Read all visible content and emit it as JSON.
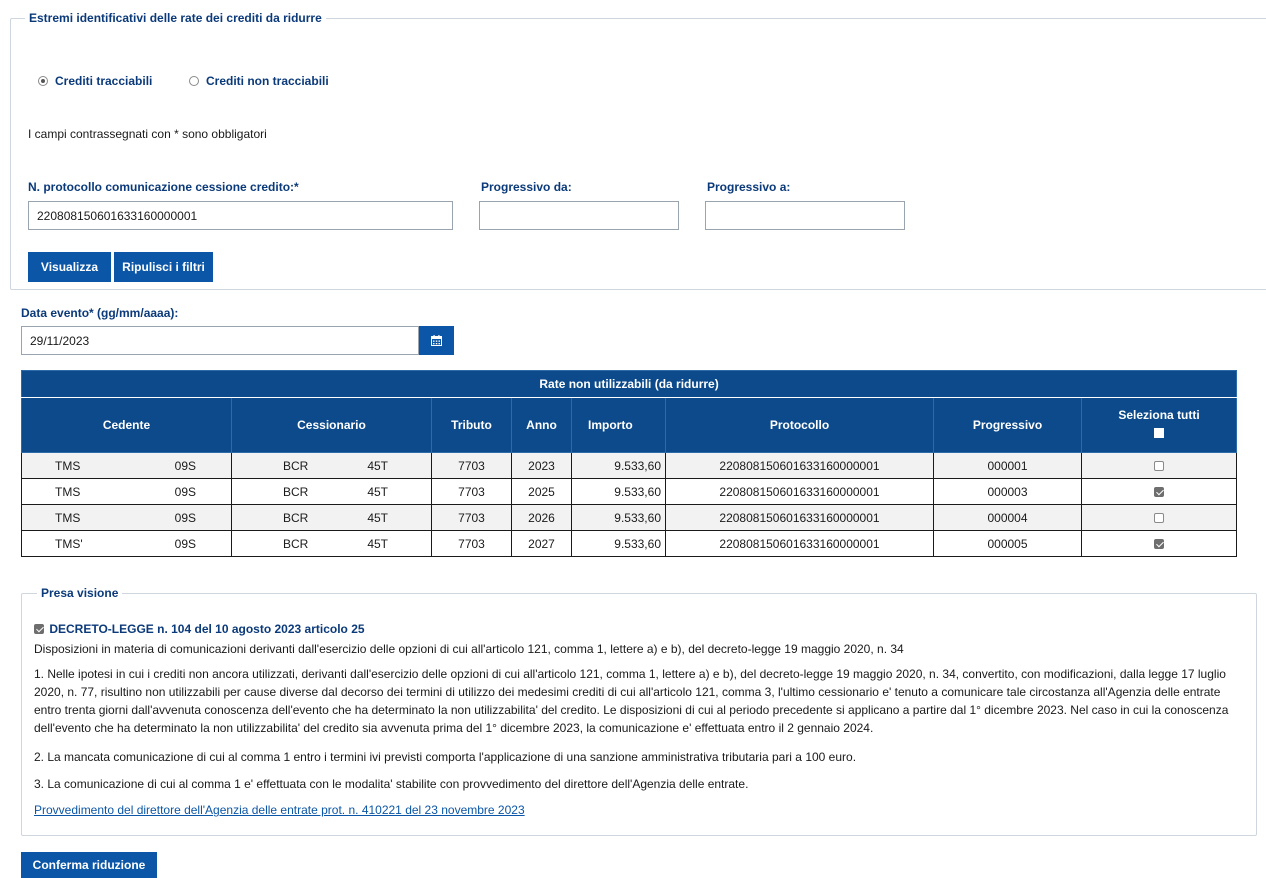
{
  "filters_section": {
    "legend": "Estremi identificativi delle rate dei crediti da ridurre",
    "radio_tracciabili": "Crediti tracciabili",
    "radio_non_tracciabili": "Crediti non tracciabili",
    "required_note": "I campi contrassegnati con * sono obbligatori",
    "protocollo_label": "N. protocollo comunicazione cessione credito:*",
    "protocollo_value": "220808150601633160000001",
    "progressivo_da_label": "Progressivo da:",
    "progressivo_da_value": "",
    "progressivo_a_label": "Progressivo a:",
    "progressivo_a_value": "",
    "btn_visualizza": "Visualizza",
    "btn_ripulisci": "Ripulisci i filtri"
  },
  "data_evento": {
    "label": "Data evento* (gg/mm/aaaa):",
    "value": "29/11/2023",
    "calendar_icon": "calendar-icon"
  },
  "table": {
    "title": "Rate non utilizzabili (da ridurre)",
    "headers": {
      "cedente": "Cedente",
      "cessionario": "Cessionario",
      "tributo": "Tributo",
      "anno": "Anno",
      "importo": "Importo",
      "protocollo": "Protocollo",
      "progressivo": "Progressivo",
      "seleziona_tutti": "Seleziona tutti"
    },
    "rows": [
      {
        "cedente_a": "TMS",
        "cedente_b": "09S",
        "cessionario_a": "BCR",
        "cessionario_b": "45T",
        "tributo": "7703",
        "anno": "2023",
        "importo": "9.533,60",
        "protocollo": "220808150601633160000001",
        "progressivo": "000001",
        "checked": false
      },
      {
        "cedente_a": "TMS",
        "cedente_b": "09S",
        "cessionario_a": "BCR",
        "cessionario_b": "45T",
        "tributo": "7703",
        "anno": "2025",
        "importo": "9.533,60",
        "protocollo": "220808150601633160000001",
        "progressivo": "000003",
        "checked": true
      },
      {
        "cedente_a": "TMS",
        "cedente_b": "09S",
        "cessionario_a": "BCR",
        "cessionario_b": "45T",
        "tributo": "7703",
        "anno": "2026",
        "importo": "9.533,60",
        "protocollo": "220808150601633160000001",
        "progressivo": "000004",
        "checked": false
      },
      {
        "cedente_a": "TMS'",
        "cedente_b": "09S",
        "cessionario_a": "BCR",
        "cessionario_b": "45T",
        "tributo": "7703",
        "anno": "2027",
        "importo": "9.533,60",
        "protocollo": "220808150601633160000001",
        "progressivo": "000005",
        "checked": true
      }
    ]
  },
  "presa_visione": {
    "legend": "Presa visione",
    "decreto_title": "DECRETO-LEGGE n. 104 del 10 agosto 2023 articolo 25",
    "subtitle": "Disposizioni in materia di comunicazioni derivanti dall'esercizio delle opzioni di cui all'articolo 121, comma 1, lettere a) e b), del decreto-legge 19 maggio 2020, n. 34",
    "comma1": "1. Nelle ipotesi in cui i crediti non ancora utilizzati, derivanti dall'esercizio delle opzioni di cui all'articolo 121, comma 1, lettere a) e b), del decreto-legge 19 maggio 2020, n. 34, convertito, con modificazioni, dalla legge 17 luglio 2020, n. 77, risultino non utilizzabili per cause diverse dal decorso dei termini di utilizzo dei medesimi crediti di cui all'articolo 121, comma 3, l'ultimo cessionario e' tenuto a comunicare tale circostanza all'Agenzia delle entrate entro trenta giorni dall'avvenuta conoscenza dell'evento che ha determinato la non utilizzabilita' del credito. Le disposizioni di cui al periodo precedente si applicano a partire dal 1° dicembre 2023. Nel caso in cui la conoscenza dell'evento che ha determinato la non utilizzabilita' del credito sia avvenuta prima del 1° dicembre 2023, la comunicazione e' effettuata entro il 2 gennaio 2024.",
    "comma2": "2. La mancata comunicazione di cui al comma 1 entro i termini ivi previsti comporta l'applicazione di una sanzione amministrativa tributaria pari a 100 euro.",
    "comma3": "3. La comunicazione di cui al comma 1 e' effettuata con le modalita' stabilite con provvedimento del direttore dell'Agenzia delle entrate.",
    "link": "Provvedimento del direttore dell'Agenzia delle entrate prot. n. 410221 del 23 novembre 2023"
  },
  "btn_conferma": "Conferma riduzione",
  "colors": {
    "primary_button": "#0b56a6",
    "table_header": "#0c4a8b",
    "label_blue": "#0b3a7a"
  }
}
